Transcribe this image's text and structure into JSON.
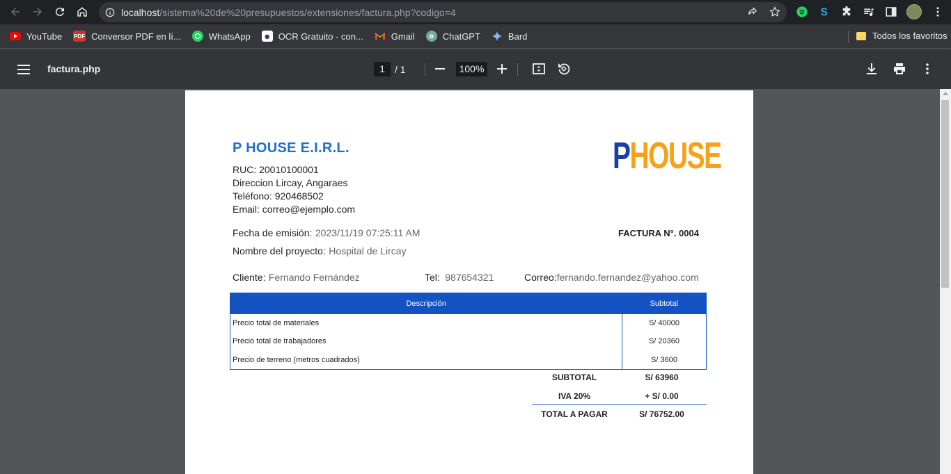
{
  "browser": {
    "url_host": "localhost",
    "url_path": "/sistema%20de%20presupuestos/extensiones/factura.php?codigo=4",
    "bookmarks": [
      {
        "label": "YouTube",
        "icon": "youtube-icon"
      },
      {
        "label": "Conversor PDF en lí...",
        "icon": "pdf-icon"
      },
      {
        "label": "WhatsApp",
        "icon": "whatsapp-icon"
      },
      {
        "label": "OCR Gratuito - con...",
        "icon": "ocr-icon"
      },
      {
        "label": "Gmail",
        "icon": "gmail-icon"
      },
      {
        "label": "ChatGPT",
        "icon": "chatgpt-icon"
      },
      {
        "label": "Bard",
        "icon": "bard-icon"
      }
    ],
    "all_bookmarks": "Todos los favoritos"
  },
  "pdf": {
    "title": "factura.php",
    "page_current": "1",
    "page_total": "/  1",
    "zoom": "100%"
  },
  "invoice": {
    "company": "P HOUSE E.I.R.L.",
    "logo_p": "P",
    "logo_house": "HOUSE",
    "ruc": "RUC: 20010100001",
    "address": "Direccion Lircay, Angaraes",
    "phone": "Teléfono: 920468502",
    "email": "Email: correo@ejemplo.com",
    "date_label": "Fecha de emisión:",
    "date_value": "2023/11/19 07:25:11 AM",
    "invoice_number": "FACTURA N°. 0004",
    "project_label": "Nombre del proyecto:",
    "project_value": "Hospital de Lircay",
    "client_label": "Cliente:",
    "client_value": "Fernando Fernández",
    "tel_label": "Tel:",
    "tel_value": "987654321",
    "mail_label": "Correo:",
    "mail_value": "fernando.fernandez@yahoo.com",
    "table_headers": {
      "desc": "Descripción",
      "subtotal": "Subtotal"
    },
    "items": [
      {
        "desc": "Precio total de materiales",
        "subtotal": "S/ 40000"
      },
      {
        "desc": "Precio total de trabajadores",
        "subtotal": "S/ 20360"
      },
      {
        "desc": "Precio de terreno (metros cuadrados)",
        "subtotal": "S/ 3600"
      }
    ],
    "subtotal_label": "SUBTOTAL",
    "subtotal_value": "S/ 63960",
    "iva_label": "IVA 20%",
    "iva_value": "+ S/ 0.00",
    "total_label": "TOTAL A PAGAR",
    "total_value": "S/ 76752.00"
  }
}
